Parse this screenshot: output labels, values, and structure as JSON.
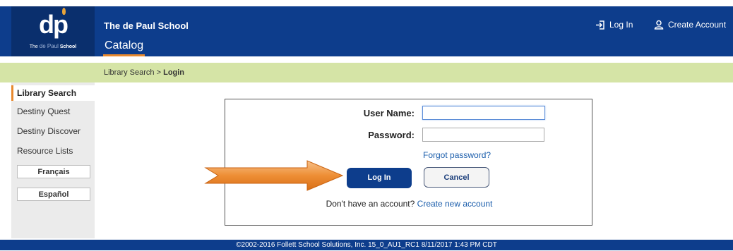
{
  "header": {
    "logo_text": "dp",
    "logo_sub": {
      "the": "The",
      "middle": "de Paul",
      "school": "School"
    },
    "school_name": "The de Paul School",
    "catalog_tab": "Catalog",
    "login_link": "Log In",
    "create_account_link": "Create Account"
  },
  "breadcrumb": {
    "parent": "Library Search",
    "sep": " > ",
    "current": "Login"
  },
  "sidebar": {
    "items": [
      {
        "label": "Library Search",
        "active": true
      },
      {
        "label": "Destiny Quest"
      },
      {
        "label": "Destiny Discover"
      },
      {
        "label": "Resource Lists"
      }
    ],
    "languages": [
      "Français",
      "Español"
    ]
  },
  "login": {
    "username_label": "User Name:",
    "username_value": "",
    "password_label": "Password:",
    "password_value": "",
    "forgot_link": "Forgot password?",
    "login_button": "Log In",
    "cancel_button": "Cancel",
    "no_account_text": "Don't have an account?",
    "create_account_link": "Create new account"
  },
  "footer": {
    "text": "©2002-2016 Follett School Solutions, Inc.   15_0_AU1_RC1   8/11/2017 1:43 PM CDT"
  },
  "colors": {
    "brand_blue": "#0d3d8c",
    "accent_orange": "#e8892e",
    "crumb_green": "#d5e4a6"
  }
}
